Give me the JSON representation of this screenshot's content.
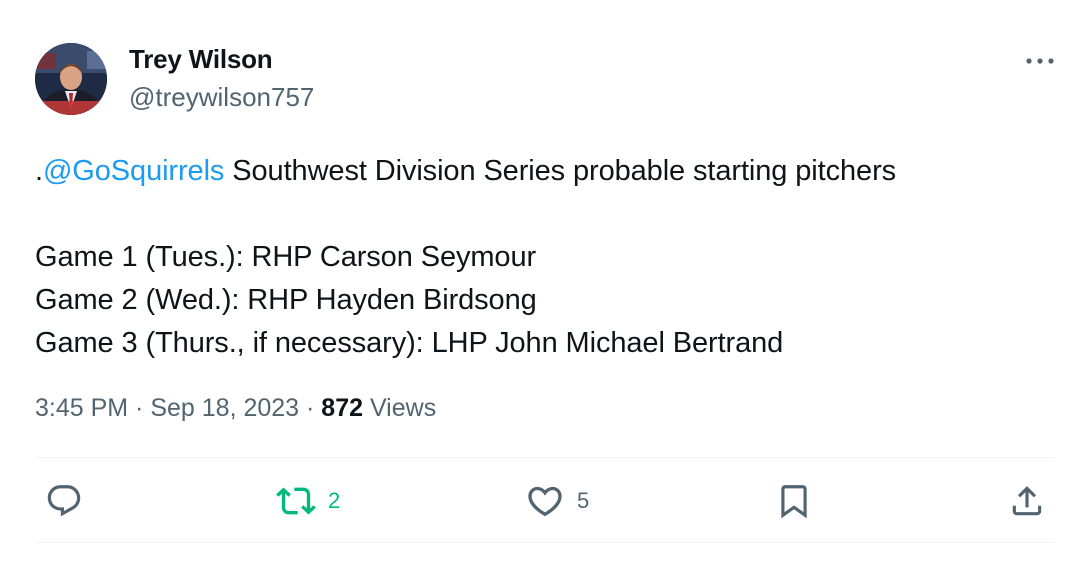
{
  "author": {
    "name": "Trey Wilson",
    "handle": "@treywilson757"
  },
  "tweet": {
    "mention_prefix": ".",
    "mention": "@GoSquirrels",
    "headline_rest": " Southwest Division Series probable starting pitchers",
    "lines": [
      "Game 1 (Tues.): RHP Carson Seymour",
      "Game 2 (Wed.): RHP Hayden Birdsong",
      "Game 3 (Thurs., if necessary): LHP John Michael Bertrand"
    ]
  },
  "meta": {
    "time": "3:45 PM",
    "separator": " · ",
    "date": "Sep 18, 2023",
    "views_count": "872",
    "views_label": " Views"
  },
  "actions": {
    "reposts": "2",
    "likes": "5"
  },
  "colors": {
    "text": "#0f1419",
    "secondary": "#536471",
    "link": "#1d9bf0",
    "repost_active": "#00ba7c",
    "divider": "#eff3f4"
  },
  "icons": [
    "avatar",
    "more-icon",
    "reply-icon",
    "repost-icon",
    "like-icon",
    "bookmark-icon",
    "share-icon"
  ]
}
